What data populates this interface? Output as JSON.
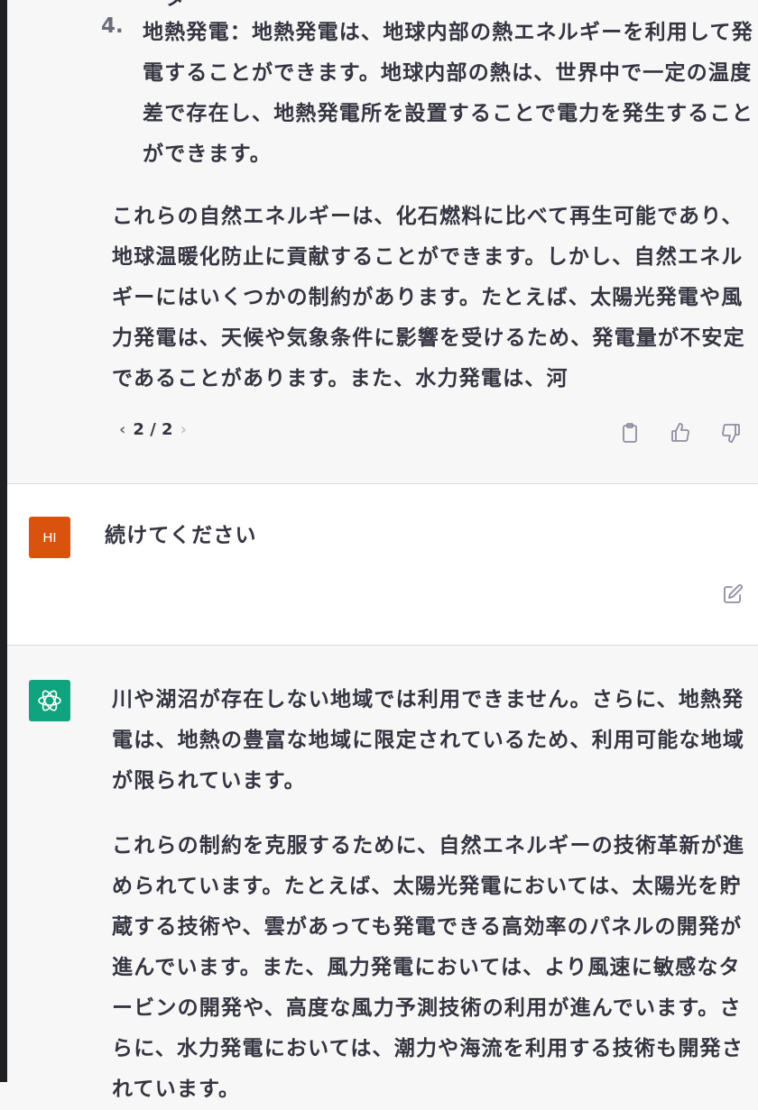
{
  "conversation": {
    "prev_answer": {
      "cut_off_line": "ーター・ーー・・ーーー・ー",
      "list_item_number": "4.",
      "list_item_text": "地熱発電：地熱発電は、地球内部の熱エネルギーを利用して発電することができます。地球内部の熱は、世界中で一定の温度差で存在し、地熱発電所を設置することで電力を発生することができます。",
      "paragraph": "これらの自然エネルギーは、化石燃料に比べて再生可能であり、地球温暖化防止に貢献することができます。しかし、自然エネルギーにはいくつかの制約があります。たとえば、太陽光発電や風力発電は、天候や気象条件に影響を受けるため、発電量が不安定であることがあります。また、水力発電は、河",
      "pager": {
        "prev": "‹",
        "label": "2 / 2",
        "next": "›"
      }
    },
    "user_message": {
      "avatar_initials": "HI",
      "text": "続けてください"
    },
    "ai_response": {
      "paragraph1": "川や湖沼が存在しない地域では利用できません。さらに、地熱発電は、地熱の豊富な地域に限定されているため、利用可能な地域が限られています。",
      "paragraph2": "これらの制約を克服するために、自然エネルギーの技術革新が進められています。たとえば、太陽光発電においては、太陽光を貯蔵する技術や、雲があっても発電できる高効率のパネルの開発が進んでいます。また、風力発電においては、より風速に敏感なタービンの開発や、高度な風力予測技術の利用が進んでいます。さらに、水力発電においては、潮力や海流を利用する技術も開発されています。"
    }
  },
  "icons": {
    "copy": "clipboard-icon",
    "like": "thumbs-up-icon",
    "dislike": "thumbs-down-icon",
    "edit": "edit-icon",
    "assistant": "openai-logo-icon"
  },
  "colors": {
    "user_avatar": "#d9530f",
    "assistant_avatar": "#10a37f",
    "ai_background": "#f7f7f8",
    "user_background": "#ffffff"
  }
}
